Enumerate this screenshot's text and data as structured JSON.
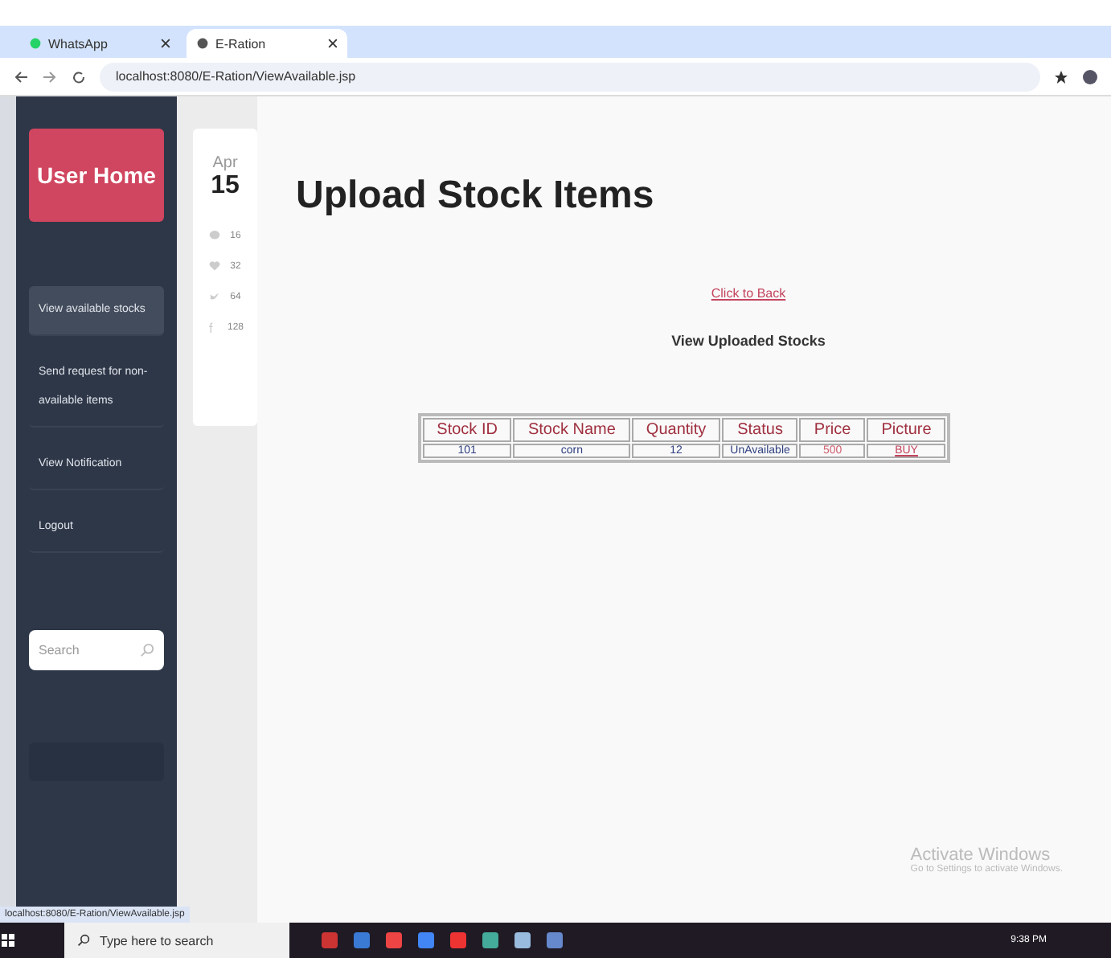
{
  "browser": {
    "tabs": [
      {
        "title": "WhatsApp",
        "selected": false
      },
      {
        "title": "E-Ration",
        "selected": true
      }
    ],
    "address": "localhost:8080/E-Ration/ViewAvailable.jsp"
  },
  "sidebar": {
    "brand": "User Home",
    "items": [
      {
        "label": "View available stocks",
        "selected": true
      },
      {
        "label": "Send request for non-available items",
        "selected": false
      },
      {
        "label": "View Notification",
        "selected": false
      },
      {
        "label": "Logout",
        "selected": false
      }
    ],
    "search": {
      "placeholder": "Search"
    }
  },
  "date_card": {
    "month": "Apr",
    "day": "15",
    "stats": [
      {
        "kind": "comment",
        "count": "16"
      },
      {
        "kind": "heart",
        "count": "32"
      },
      {
        "kind": "twitter",
        "count": "64"
      },
      {
        "kind": "facebook",
        "count": "128"
      }
    ]
  },
  "page": {
    "title": "Upload Stock Items",
    "back_link": "Click to Back",
    "subtitle": "View Uploaded Stocks"
  },
  "table": {
    "columns": [
      "Stock ID",
      "Stock Name",
      "Quantity",
      "Status",
      "Price",
      "Picture"
    ],
    "rows": [
      {
        "id": "101",
        "name": "corn",
        "quantity": "12",
        "status": "UnAvailable",
        "price": "500",
        "picture": "BUY"
      }
    ]
  },
  "status_url": "localhost:8080/E-Ration/ViewAvailable.jsp",
  "activation": {
    "title": "Activate Windows",
    "subtitle": "Go to Settings to activate Windows."
  },
  "taskbar": {
    "search_placeholder": "Type here to search",
    "time": "9:38 PM"
  }
}
